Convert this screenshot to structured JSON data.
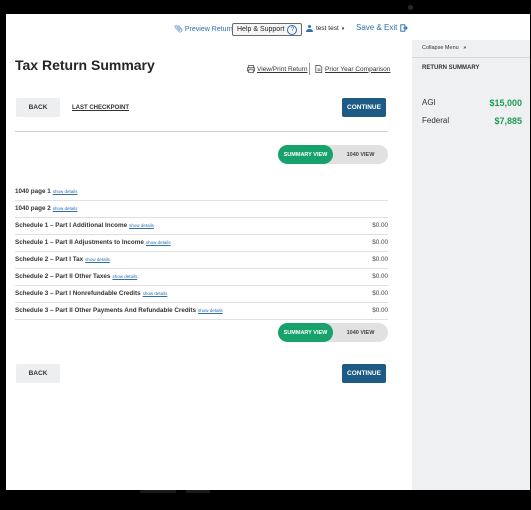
{
  "topnav": {
    "preview_return": "Preview Return",
    "help_support": "Help & Support",
    "user_name": "test test",
    "save_exit": "Save & Exit"
  },
  "main": {
    "title": "Tax Return Summary",
    "view_print": "View/Print Return",
    "prior_year": "Prior Year Comparison",
    "back_label": "BACK",
    "last_checkpoint": "LAST CHECKPOINT",
    "continue_label": "CONTINUE",
    "toggle": {
      "summary_view": "SUMMARY VIEW",
      "form_view": "1040 VIEW"
    }
  },
  "rows": [
    {
      "label": "1040 page 1",
      "link": "show details",
      "amount": ""
    },
    {
      "label": "1040 page 2",
      "link": "show details",
      "amount": ""
    },
    {
      "label": "Schedule 1 – Part I Additional Income",
      "link": "show details",
      "amount": "$0.00"
    },
    {
      "label": "Schedule 1 – Part II Adjustments to Income",
      "link": "show details",
      "amount": "$0.00"
    },
    {
      "label": "Schedule 2 – Part I Tax",
      "link": "show details",
      "amount": "$0.00"
    },
    {
      "label": "Schedule 2 – Part II Other Taxes",
      "link": "show details",
      "amount": "$0.00"
    },
    {
      "label": "Schedule 3 – Part I Nonrefundable Credits",
      "link": "show details",
      "amount": "$0.00"
    },
    {
      "label": "Schedule 3 – Part II Other Payments And Refundable Credits",
      "link": "show details",
      "amount": "$0.00"
    }
  ],
  "panel": {
    "collapse": "Collapse Menu",
    "title": "RETURN SUMMARY",
    "agi_label": "AGI",
    "agi_value": "$15,000",
    "federal_label": "Federal",
    "federal_value": "$7,885"
  },
  "colors": {
    "accent_blue": "#2d6fb0",
    "continue_bg": "#1d5a86",
    "toggle_green": "#17a16b",
    "amount_green": "#1f9a56"
  },
  "icons": [
    "paperclip-icon",
    "question-circle-icon",
    "user-icon",
    "chevron-down-icon",
    "exit-icon",
    "printer-icon",
    "document-icon",
    "double-chevron-right-icon"
  ]
}
